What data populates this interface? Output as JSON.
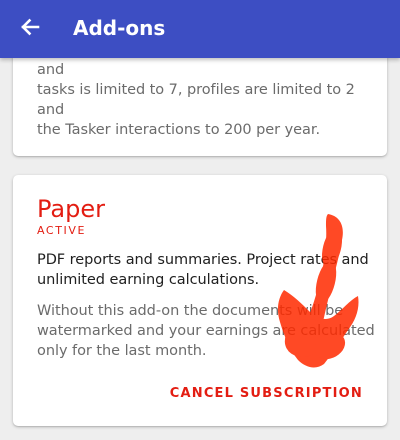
{
  "app_bar": {
    "title": "Add-ons",
    "back_icon": "arrow-left-icon",
    "background_color": "#3d4ec3"
  },
  "addons": [
    {
      "description_lines": [
        "Without this add-on the number of projects and",
        "tasks is limited to 7, profiles are limited to 2 and",
        "the Tasker interactions to 200 per year."
      ]
    },
    {
      "name": "Paper",
      "status": "ACTIVE",
      "description_lines": [
        "PDF reports and summaries. Project rates and",
        "unlimited earning calculations."
      ],
      "note_lines": [
        "Without this add-on the documents will be",
        "watermarked and your earnings are calculated",
        "only for the last month."
      ],
      "action_label": "CANCEL SUBSCRIPTION",
      "accent_color": "#e31d12"
    }
  ],
  "annotation": {
    "icon": "hand-drawn-arrow-icon",
    "color": "#ff2a00"
  }
}
